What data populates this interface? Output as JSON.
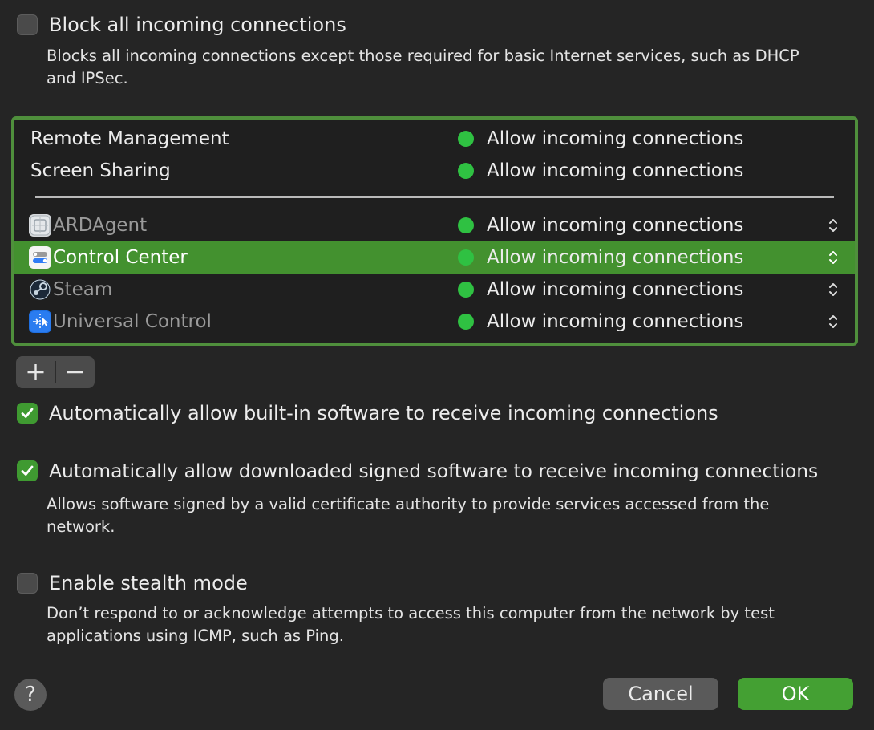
{
  "block_all": {
    "label": "Block all incoming connections",
    "description": "Blocks all incoming connections except those required for basic Internet services, such as DHCP and IPSec.",
    "checked": false
  },
  "services": [
    {
      "name": "Remote Management",
      "status": "Allow incoming connections"
    },
    {
      "name": "Screen Sharing",
      "status": "Allow incoming connections"
    }
  ],
  "apps": [
    {
      "name": "ARDAgent",
      "status": "Allow incoming connections",
      "icon": "ardagent-icon",
      "selected": false
    },
    {
      "name": "Control Center",
      "status": "Allow incoming connections",
      "icon": "control-center-icon",
      "selected": true
    },
    {
      "name": "Steam",
      "status": "Allow incoming connections",
      "icon": "steam-icon",
      "selected": false
    },
    {
      "name": "Universal Control",
      "status": "Allow incoming connections",
      "icon": "universal-control-icon",
      "selected": false
    }
  ],
  "list_controls": {
    "add": "+",
    "remove": "−"
  },
  "auto_builtin": {
    "label": "Automatically allow built-in software to receive incoming connections",
    "checked": true
  },
  "auto_signed": {
    "label": "Automatically allow downloaded signed software to receive incoming connections",
    "description": "Allows software signed by a valid certificate authority to provide services accessed from the network.",
    "checked": true
  },
  "stealth": {
    "label": "Enable stealth mode",
    "description": "Don’t respond to or acknowledge attempts to access this computer from the network by test applications using ICMP, such as Ping.",
    "checked": false
  },
  "help": "?",
  "buttons": {
    "cancel": "Cancel",
    "ok": "OK"
  },
  "colors": {
    "accent": "#43912f",
    "status_dot": "#2fc142",
    "background": "#252525"
  }
}
